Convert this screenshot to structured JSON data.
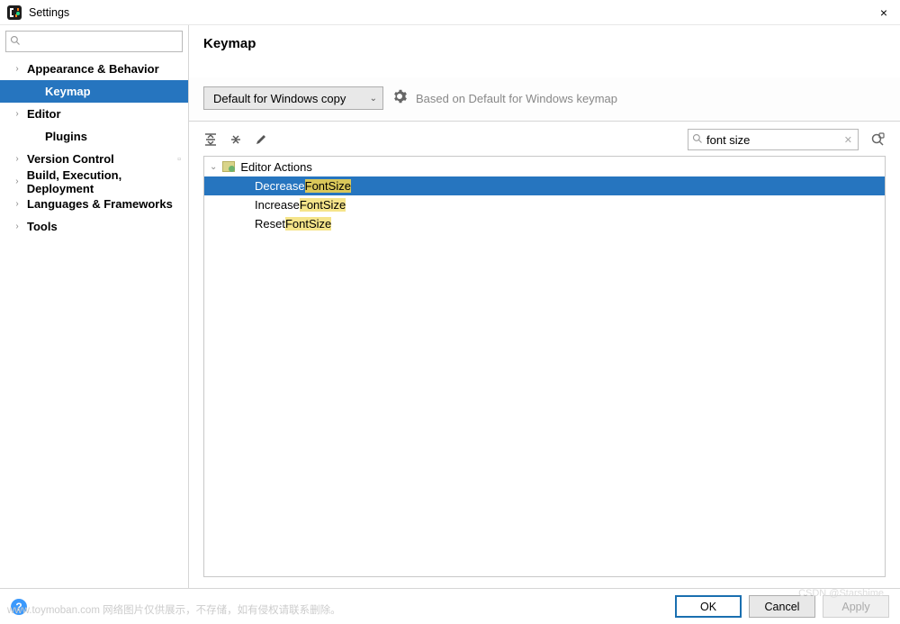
{
  "window": {
    "title": "Settings",
    "close": "×"
  },
  "sidebar": {
    "search_placeholder": "",
    "items": [
      {
        "label": "Appearance & Behavior",
        "expandable": true,
        "selected": false
      },
      {
        "label": "Keymap",
        "expandable": false,
        "selected": true,
        "child": true
      },
      {
        "label": "Editor",
        "expandable": true,
        "selected": false
      },
      {
        "label": "Plugins",
        "expandable": false,
        "selected": false,
        "child": true
      },
      {
        "label": "Version Control",
        "expandable": true,
        "selected": false,
        "trailing_icon": true
      },
      {
        "label": "Build, Execution, Deployment",
        "expandable": true,
        "selected": false
      },
      {
        "label": "Languages & Frameworks",
        "expandable": true,
        "selected": false
      },
      {
        "label": "Tools",
        "expandable": true,
        "selected": false
      }
    ]
  },
  "main": {
    "heading": "Keymap",
    "scheme_select": "Default for Windows copy",
    "based_on": "Based on Default for Windows keymap",
    "search_value": "font size",
    "group_label": "Editor Actions",
    "actions": [
      {
        "pre": "Decrease ",
        "hl1": "Font",
        "mid": " ",
        "hl2": "Size",
        "selected": true
      },
      {
        "pre": "Increase ",
        "hl1": "Font",
        "mid": " ",
        "hl2": "Size",
        "selected": false
      },
      {
        "pre": "Reset ",
        "hl1": "Font",
        "mid": " ",
        "hl2": "Size",
        "selected": false
      }
    ]
  },
  "buttons": {
    "ok": "OK",
    "cancel": "Cancel",
    "apply": "Apply"
  },
  "watermark": "www.toymoban.com  网络图片仅供展示，不存储，如有侵权请联系删除。",
  "watermark2": "CSDN @Starshime"
}
